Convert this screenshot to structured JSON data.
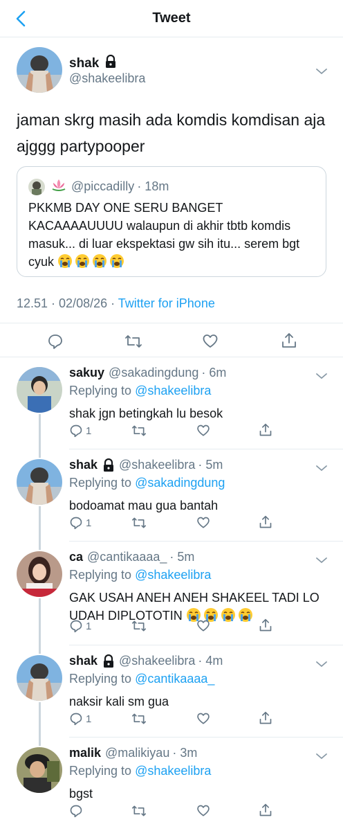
{
  "header": {
    "title": "Tweet"
  },
  "main": {
    "name": "shak",
    "handle": "@shakeelibra",
    "text": "jaman skrg masih ada komdis komdisan aja ajggg partypooper",
    "quote": {
      "handle": "@piccadilly",
      "time": "· 18m",
      "text": "PKKMB DAY ONE SERU BANGET KACAAAAUUUU walaupun di akhir tbtb komdis masuk... di luar ekspektasi gw sih itu... serem bgt cyuk"
    },
    "time": "12.51 · 02/08/26 · ",
    "source": "Twitter for iPhone"
  },
  "replies": [
    {
      "name": "sakuy",
      "handle": "@sakadingdung",
      "time": "· 6m",
      "replying_label": "Replying to",
      "replying_to": "@shakeelibra",
      "text": "shak jgn betingkah lu besok",
      "reply_count": "1",
      "locked": false
    },
    {
      "name": "shak",
      "handle": "@shakeelibra",
      "time": "· 5m",
      "replying_label": "Replying to",
      "replying_to": "@sakadingdung",
      "text": "bodoamat mau gua bantah",
      "reply_count": "1",
      "locked": true
    },
    {
      "name": "ca",
      "handle": "@cantikaaaa_",
      "time": "· 5m",
      "replying_label": "Replying to",
      "replying_to": "@shakeelibra",
      "text": "GAK USAH ANEH ANEH SHAKEEL TADI LO UDAH DIPLOTOTIN",
      "reply_count": "1",
      "locked": false
    },
    {
      "name": "shak",
      "handle": "@shakeelibra",
      "time": "· 4m",
      "replying_label": "Replying to",
      "replying_to": "@cantikaaaa_",
      "text": "naksir kali sm gua",
      "reply_count": "1",
      "locked": true
    },
    {
      "name": "malik",
      "handle": "@malikiyau",
      "time": "· 3m",
      "replying_label": "Replying to",
      "replying_to": "@shakeelibra",
      "text": "bgst",
      "reply_count": "",
      "locked": false
    }
  ],
  "colors": {
    "accent": "#1da1f2",
    "secondary": "#657786",
    "divider": "#e6ecf0"
  }
}
